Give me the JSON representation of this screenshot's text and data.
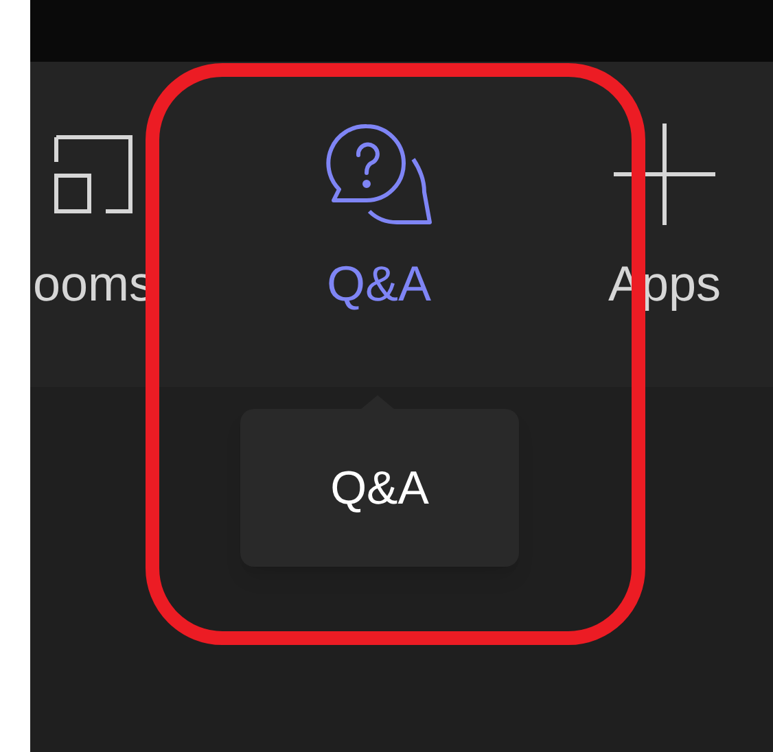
{
  "toolbar": {
    "items": [
      {
        "label": "ooms",
        "kind": "rooms",
        "selected": false
      },
      {
        "label": "Q&A",
        "kind": "qa",
        "selected": true
      },
      {
        "label": "Apps",
        "kind": "apps",
        "selected": false
      }
    ]
  },
  "tooltip": {
    "text": "Q&A"
  }
}
